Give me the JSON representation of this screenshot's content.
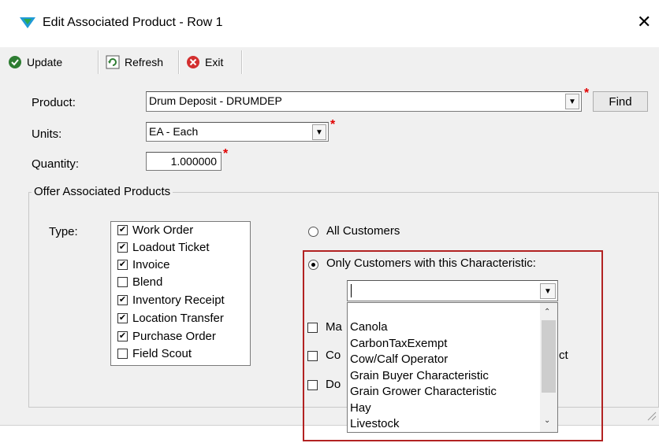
{
  "window": {
    "title": "Edit Associated Product - Row 1",
    "close_glyph": "✕"
  },
  "toolbar": {
    "update": "Update",
    "refresh": "Refresh",
    "exit": "Exit"
  },
  "form": {
    "product_label": "Product:",
    "product_value": "Drum Deposit - DRUMDEP",
    "find": "Find",
    "units_label": "Units:",
    "units_value": "EA - Each",
    "quantity_label": "Quantity:",
    "quantity_value": "1.000000",
    "required_mark": "*"
  },
  "group": {
    "title": "Offer Associated Products",
    "type_label": "Type:",
    "types": [
      {
        "label": "Work Order",
        "checked": true
      },
      {
        "label": "Loadout Ticket",
        "checked": true
      },
      {
        "label": "Invoice",
        "checked": true
      },
      {
        "label": "Blend",
        "checked": false
      },
      {
        "label": "Inventory Receipt",
        "checked": true
      },
      {
        "label": "Location Transfer",
        "checked": true
      },
      {
        "label": "Purchase Order",
        "checked": true
      },
      {
        "label": "Field Scout",
        "checked": false
      }
    ],
    "all_customers": "All Customers",
    "only_customers": "Only Customers with this Characteristic:",
    "characteristic_value": "",
    "hidden_checkboxes": [
      {
        "partial_left": "Ma",
        "partial_right": ""
      },
      {
        "partial_left": "Co",
        "partial_right": "ct"
      },
      {
        "partial_left": "Do",
        "partial_right": ""
      }
    ],
    "characteristics": [
      "Canola",
      "CarbonTaxExempt",
      "Cow/Calf Operator",
      "Grain Buyer Characteristic",
      "Grain Grower Characteristic",
      "Hay",
      "Livestock"
    ]
  },
  "colors": {
    "highlight": "#b22222",
    "required": "#e00000",
    "update_icon": "#2e7d32",
    "exit_icon": "#d32f2f",
    "logo": "#1f9ad6"
  }
}
